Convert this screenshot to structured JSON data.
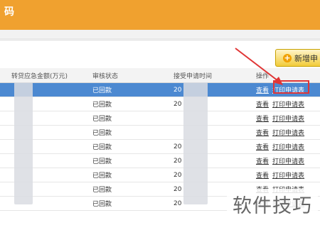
{
  "header": {
    "title": "码"
  },
  "toolbar": {
    "add_button_label": "新增申"
  },
  "table": {
    "columns": [
      "",
      "转贷应急金额(万元)",
      "审核状态",
      "接受申请时间",
      "操作"
    ],
    "rows": [
      {
        "status": "已回款",
        "time": "20",
        "view": "查看",
        "print": "打印申请表"
      },
      {
        "status": "已回款",
        "time": "20",
        "view": "查看",
        "print": "打印申请表"
      },
      {
        "status": "已回款",
        "time": "",
        "view": "查看",
        "print": "打印申请表"
      },
      {
        "status": "已回款",
        "time": "",
        "view": "查看",
        "print": "打印申请表"
      },
      {
        "status": "已回款",
        "time": "20",
        "view": "查看",
        "print": "打印申请表"
      },
      {
        "status": "已回款",
        "time": "20",
        "view": "查看",
        "print": "打印申请表"
      },
      {
        "status": "已回款",
        "time": "20",
        "view": "查看",
        "print": "打印申请表"
      },
      {
        "status": "已回款",
        "time": "20",
        "view": "查看",
        "print": "打印申请表"
      },
      {
        "status": "已回款",
        "time": "20",
        "view": "查看",
        "print": "打印申请表"
      }
    ]
  },
  "watermark": {
    "text": "软件技巧"
  },
  "colors": {
    "header": "#f0a12f",
    "selected_row": "#4c89d1",
    "highlight": "#e03535"
  }
}
